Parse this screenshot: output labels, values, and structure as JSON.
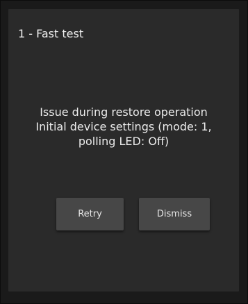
{
  "dialog": {
    "title": "1 - Fast test",
    "message_lines": [
      "Issue during restore operation",
      "Initial device settings (mode: 1,",
      "polling LED: Off)"
    ],
    "retry_label": "Retry",
    "dismiss_label": "Dismiss"
  },
  "colors": {
    "background": "#1a1a1a",
    "dialog": "#2a2a2a",
    "button": "#474747",
    "text": "#ececec"
  }
}
